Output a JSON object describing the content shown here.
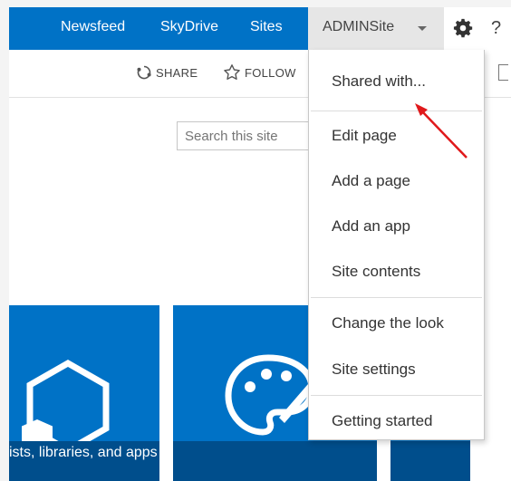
{
  "suite_nav": {
    "links": [
      "Newsfeed",
      "SkyDrive",
      "Sites"
    ],
    "site_menu_label": "ADMINSite",
    "help_glyph": "?",
    "settings_icon": "gear-icon"
  },
  "ribbon": {
    "share_label": "SHARE",
    "follow_label": "FOLLOW",
    "share_icon": "share-icon",
    "follow_icon": "star-icon"
  },
  "search": {
    "placeholder": "Search this site"
  },
  "tiles": [
    {
      "label": "ists, libraries, and apps",
      "icon": "hexagon-icon"
    },
    {
      "label": "",
      "icon": "palette-icon"
    },
    {
      "label": "",
      "icon": ""
    }
  ],
  "settings_menu": {
    "items": [
      "Shared with...",
      "Edit page",
      "Add a page",
      "Add an app",
      "Site contents",
      "Change the look",
      "Site settings",
      "Getting started"
    ],
    "annotation": "red-arrow pointing to Shared with..."
  },
  "colors": {
    "brand_blue": "#0072c6",
    "dark_blue": "#004e8c",
    "menu_bg": "#ffffff",
    "annotation_red": "#e0191b"
  }
}
